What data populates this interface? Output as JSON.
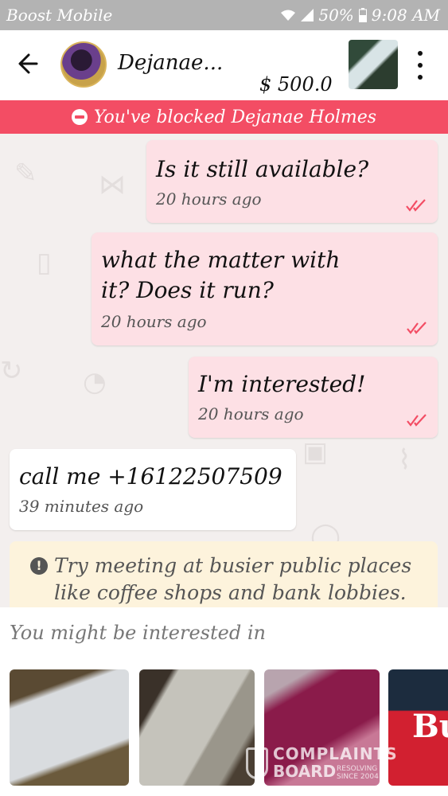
{
  "status_bar": {
    "carrier": "Boost Mobile",
    "battery": "50%",
    "time": "9:08 AM"
  },
  "header": {
    "name": "Dejanae...",
    "price": "$ 500.0"
  },
  "banner": {
    "text": "You've blocked Dejanae Holmes",
    "color": "#f34d64"
  },
  "messages": [
    {
      "direction": "out",
      "lines": [
        "Is it still available?"
      ],
      "time": "20 hours ago"
    },
    {
      "direction": "out",
      "lines": [
        "what the matter with",
        "it? Does it run?"
      ],
      "time": "20 hours ago"
    },
    {
      "direction": "out",
      "lines": [
        "I'm interested!"
      ],
      "time": "20 hours ago"
    },
    {
      "direction": "in",
      "lines": [
        "call me +16122507509"
      ],
      "time": "39 minutes ago"
    }
  ],
  "tip": {
    "line1": "Try meeting at busier public places",
    "line2": "like coffee shops and bank lobbies."
  },
  "suggestions": {
    "title": "You might be interested in",
    "card4_text": "Bu"
  },
  "watermark": {
    "line1": "COMPLAINTS",
    "line2": "BOARD",
    "small1": "RESOLVING",
    "small2": "SINCE 2004"
  },
  "colors": {
    "outgoing_bubble": "#fde0e5",
    "incoming_bubble": "#ffffff",
    "tip_background": "#fdf3dc",
    "read_check": "#f34d64"
  }
}
